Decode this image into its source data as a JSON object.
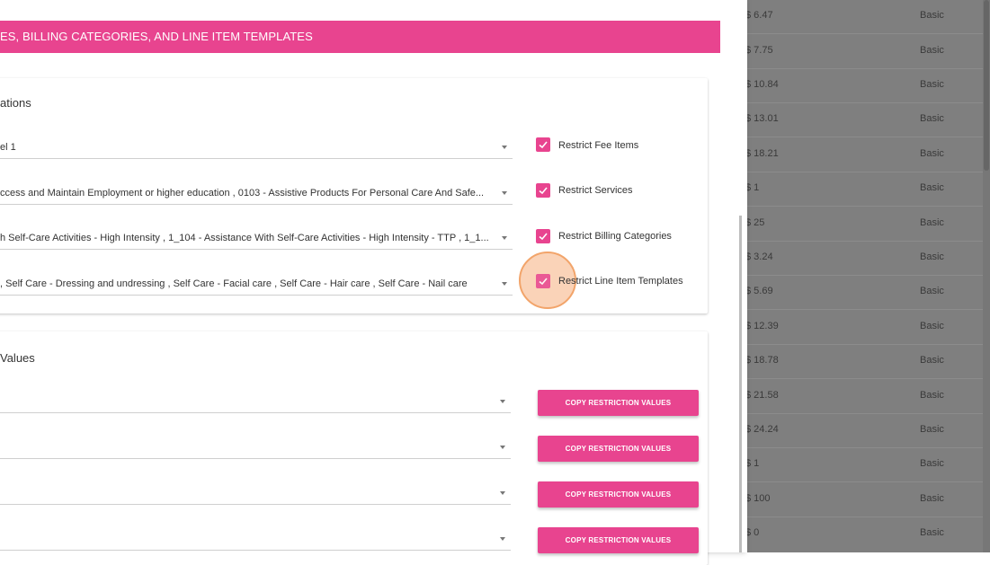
{
  "header": {
    "title": "ES, BILLING CATEGORIES, AND LINE ITEM TEMPLATES"
  },
  "restrictions_card": {
    "title": "ations",
    "rows": [
      {
        "value": "el 1",
        "checkbox_label": "Restrict Fee Items",
        "checked": true
      },
      {
        "value": "ccess and Maintain Employment or higher education , 0103 - Assistive Products For Personal Care And Safe...",
        "checkbox_label": "Restrict Services",
        "checked": true
      },
      {
        "value": "h Self-Care Activities - High Intensity , 1_104 - Assistance With Self-Care Activities - High Intensity - TTP , 1_1...",
        "checkbox_label": "Restrict Billing Categories",
        "checked": true
      },
      {
        "value": ", Self Care - Dressing and undressing , Self Care - Facial care , Self Care - Hair care , Self Care - Nail care",
        "checkbox_label": "Restrict Line Item Templates",
        "checked": true
      }
    ]
  },
  "values_card": {
    "title": "Values",
    "copy_label": "COPY RESTRICTION VALUES"
  },
  "background_table": {
    "rows": [
      {
        "amount": "$ 6.47",
        "plan": "Basic"
      },
      {
        "amount": "$ 7.75",
        "plan": "Basic"
      },
      {
        "amount": "$ 10.84",
        "plan": "Basic"
      },
      {
        "amount": "$ 13.01",
        "plan": "Basic"
      },
      {
        "amount": "$ 18.21",
        "plan": "Basic"
      },
      {
        "amount": "$ 1",
        "plan": "Basic"
      },
      {
        "amount": "$ 25",
        "plan": "Basic"
      },
      {
        "amount": "$ 3.24",
        "plan": "Basic"
      },
      {
        "amount": "$ 5.69",
        "plan": "Basic"
      },
      {
        "amount": "$ 12.39",
        "plan": "Basic"
      },
      {
        "amount": "$ 18.78",
        "plan": "Basic"
      },
      {
        "amount": "$ 21.58",
        "plan": "Basic"
      },
      {
        "amount": "$ 24.24",
        "plan": "Basic"
      },
      {
        "amount": "$ 1",
        "plan": "Basic"
      },
      {
        "amount": "$ 100",
        "plan": "Basic"
      },
      {
        "amount": "$ 0",
        "plan": "Basic"
      }
    ]
  },
  "colors": {
    "accent": "#e8448f",
    "overlay": "#7f7f7f",
    "ripple": "#f2a46a"
  }
}
